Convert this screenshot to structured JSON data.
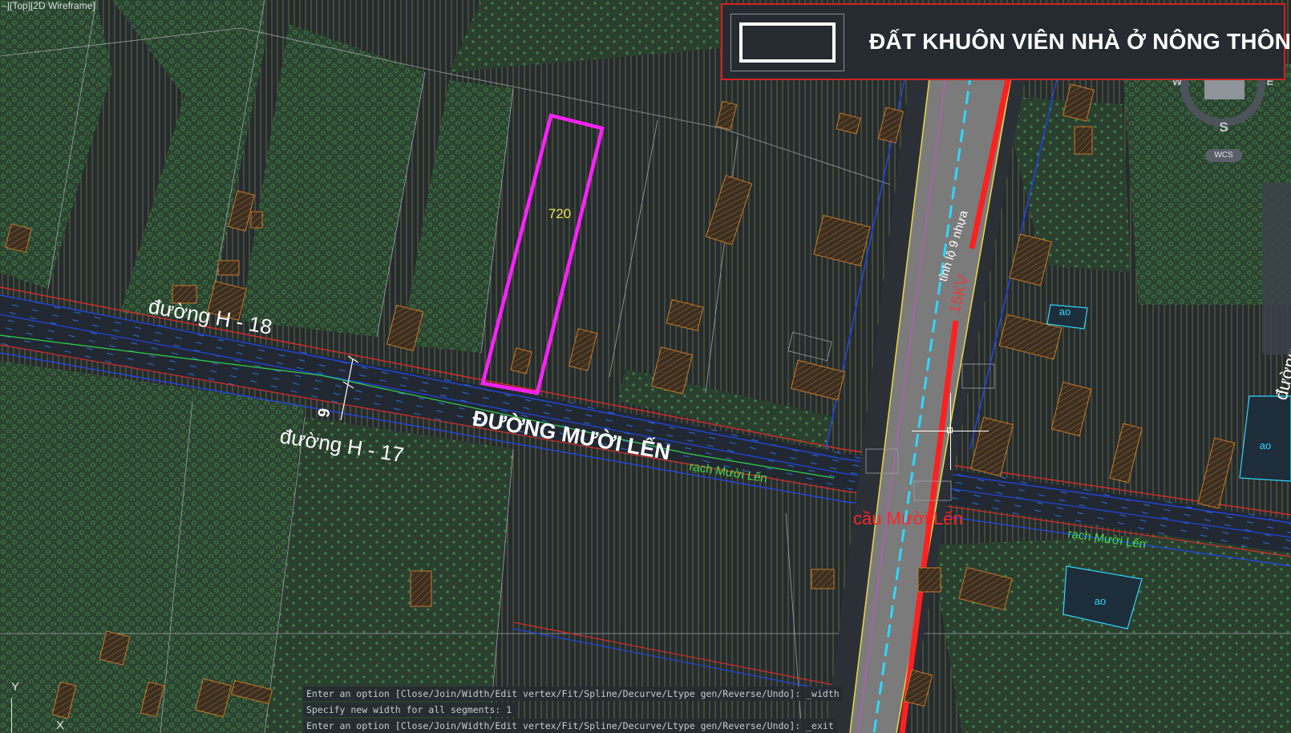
{
  "viewport": {
    "label": "–][Top][2D Wireframe]"
  },
  "legend": {
    "text": "ĐẤT KHUÔN VIÊN NHÀ Ở NÔNG THÔN",
    "swatch_color": "#ffffff",
    "border_color": "#d42020"
  },
  "map": {
    "parcel_number": "720",
    "road_h18": "đường H - 18",
    "road_h17": "đường H - 17",
    "road_main": "ĐƯỜNG MƯỜI LẾN",
    "road_width_label": "6",
    "canal_label_1": "rạch Mười Lến",
    "canal_label_2": "rạch Mười Lến",
    "bridge_label": "cầu Mười Lến",
    "provincial_road": "tỉnh lộ 9 nhựa",
    "power_line": "15KV",
    "pond_1": "ao",
    "pond_2": "ao",
    "pond_3": "ao",
    "edge_road": "đường",
    "colors": {
      "background": "#262b31",
      "parcel_highlight": "#ff20ff",
      "vegetation": "#2f4a33",
      "building_fill": "#7a4a1e",
      "road_asphalt": "#7d7d7d",
      "canal_line": "#1a5cff",
      "center_line": "#2fd8ff",
      "red_line": "#ff2020"
    }
  },
  "compass": {
    "south": "S",
    "west": "W",
    "east": "E"
  },
  "wcs_label": "WCS",
  "ucs": {
    "y": "Y",
    "x": "X"
  },
  "command": {
    "lines": [
      "Enter an option [Close/Join/Width/Edit vertex/Fit/Spline/Decurve/Ltype gen/Reverse/Undo]: _width",
      "Specify new width for all segments: 1",
      "Enter an option [Close/Join/Width/Edit vertex/Fit/Spline/Decurve/Ltype gen/Reverse/Undo]: _exit"
    ]
  }
}
